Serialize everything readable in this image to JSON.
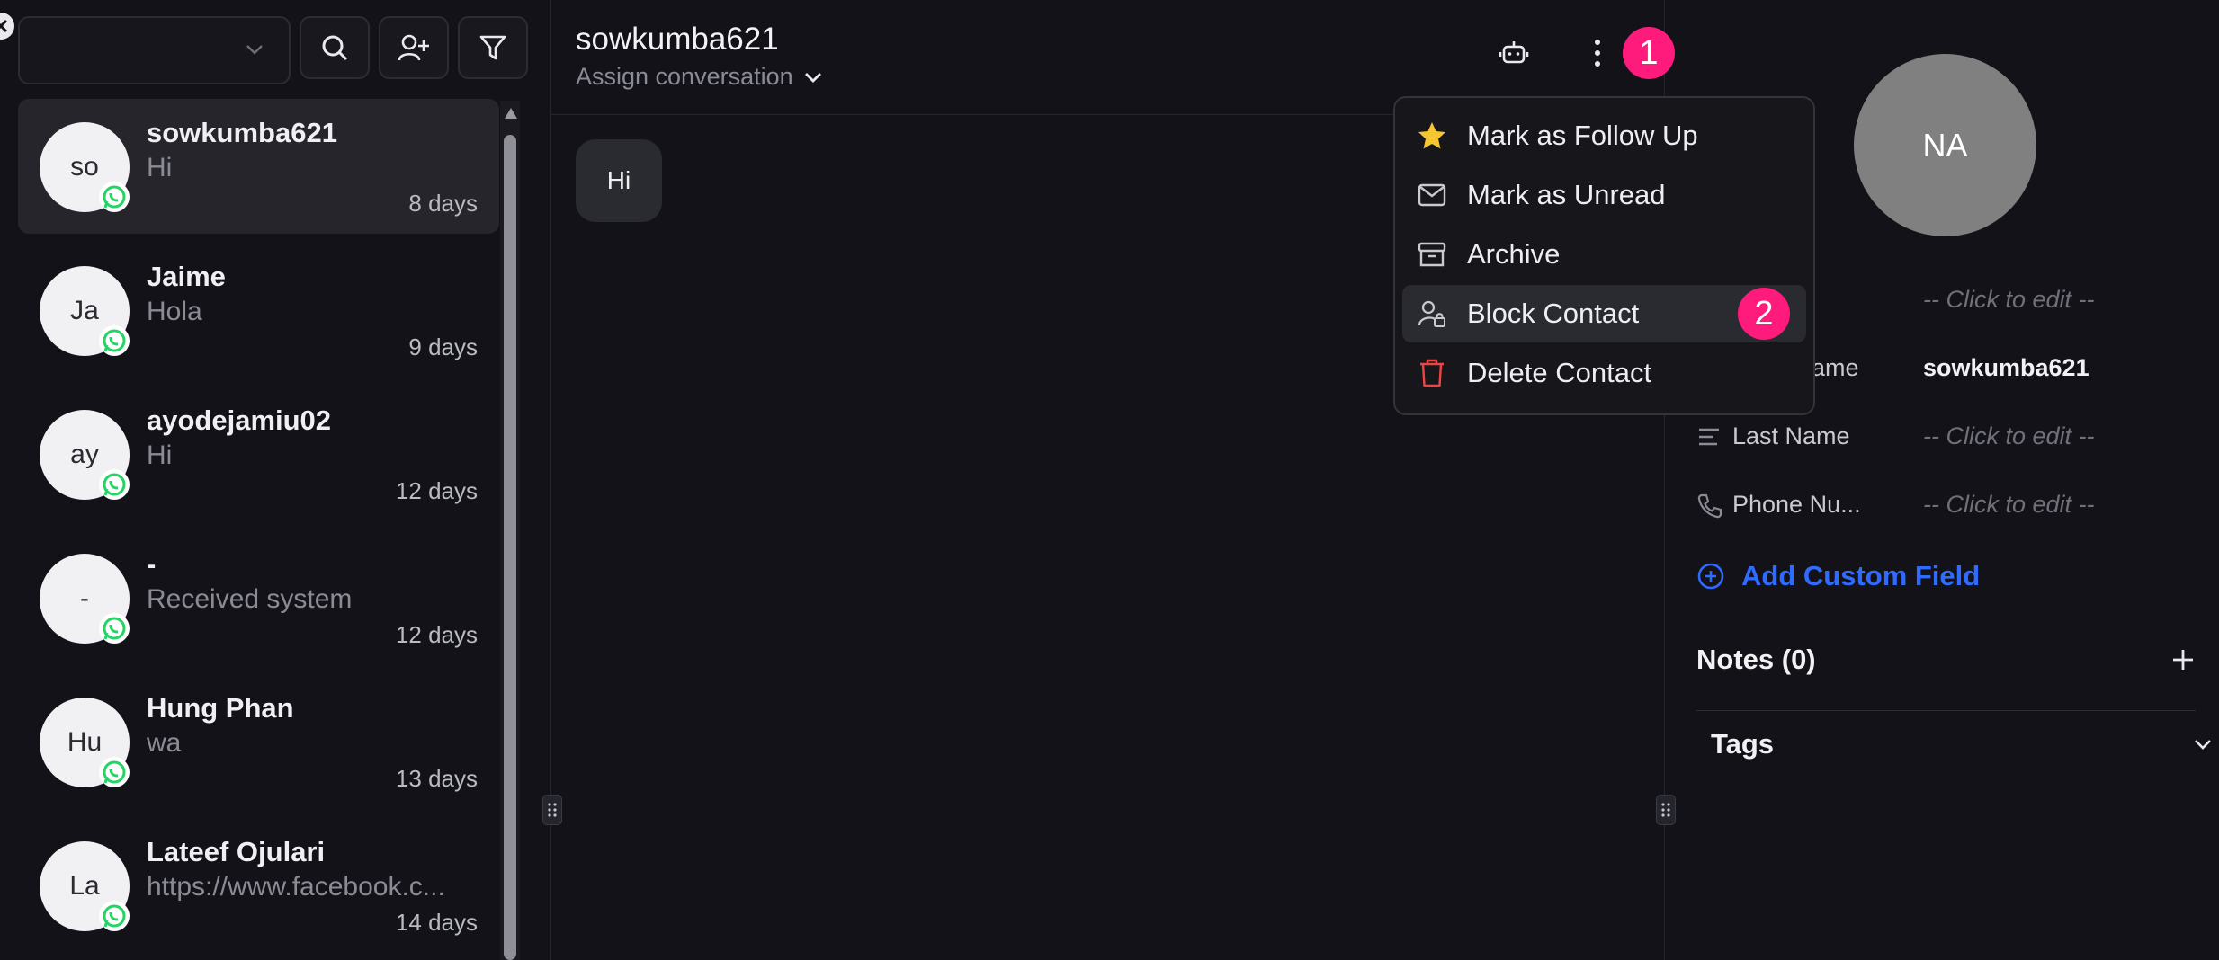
{
  "sidebar": {
    "account_select": {
      "value": ""
    },
    "conversations": [
      {
        "initials": "so",
        "name": "sowkumba621",
        "preview": "Hi",
        "time": "8 days",
        "active": true
      },
      {
        "initials": "Ja",
        "name": "Jaime",
        "preview": "Hola",
        "time": "9 days"
      },
      {
        "initials": "ay",
        "name": "ayodejamiu02",
        "preview": "Hi",
        "time": "12 days"
      },
      {
        "initials": "-",
        "name": "-",
        "preview": "Received system",
        "time": "12 days"
      },
      {
        "initials": "Hu",
        "name": "Hung Phan",
        "preview": "wa",
        "time": "13 days"
      },
      {
        "initials": "La",
        "name": "Lateef Ojulari",
        "preview": "https://www.facebook.c...",
        "time": "14 days"
      }
    ]
  },
  "chat": {
    "contact_name": "sowkumba621",
    "assign_label": "Assign conversation",
    "messages": [
      {
        "text": "Hi"
      }
    ],
    "badges": {
      "more": "1",
      "block": "2"
    }
  },
  "menu": {
    "items": [
      {
        "label": "Mark as Follow Up",
        "icon": "star-icon"
      },
      {
        "label": "Mark as Unread",
        "icon": "mail-icon"
      },
      {
        "label": "Archive",
        "icon": "archive-icon"
      },
      {
        "label": "Block Contact",
        "icon": "user-lock-icon"
      },
      {
        "label": "Delete Contact",
        "icon": "trash-icon"
      }
    ]
  },
  "contact_panel": {
    "avatar_initials": "NA",
    "fields": [
      {
        "label": "",
        "value": "-- Click to edit --"
      },
      {
        "label": "ame",
        "value": "sowkumba621"
      },
      {
        "label": "Last Name",
        "value": "-- Click to edit --"
      },
      {
        "label": "Phone Nu...",
        "value": "-- Click to edit --"
      }
    ],
    "add_custom_field": "Add Custom Field",
    "notes_title": "Notes (0)",
    "tags_title": "Tags"
  },
  "colors": {
    "background": "#121218",
    "accent_blue": "#2f6bff",
    "badge_pink": "#ff1b7b",
    "whatsapp_green": "#25d366",
    "star_yellow": "#f7c531",
    "danger_red": "#ef4444"
  }
}
